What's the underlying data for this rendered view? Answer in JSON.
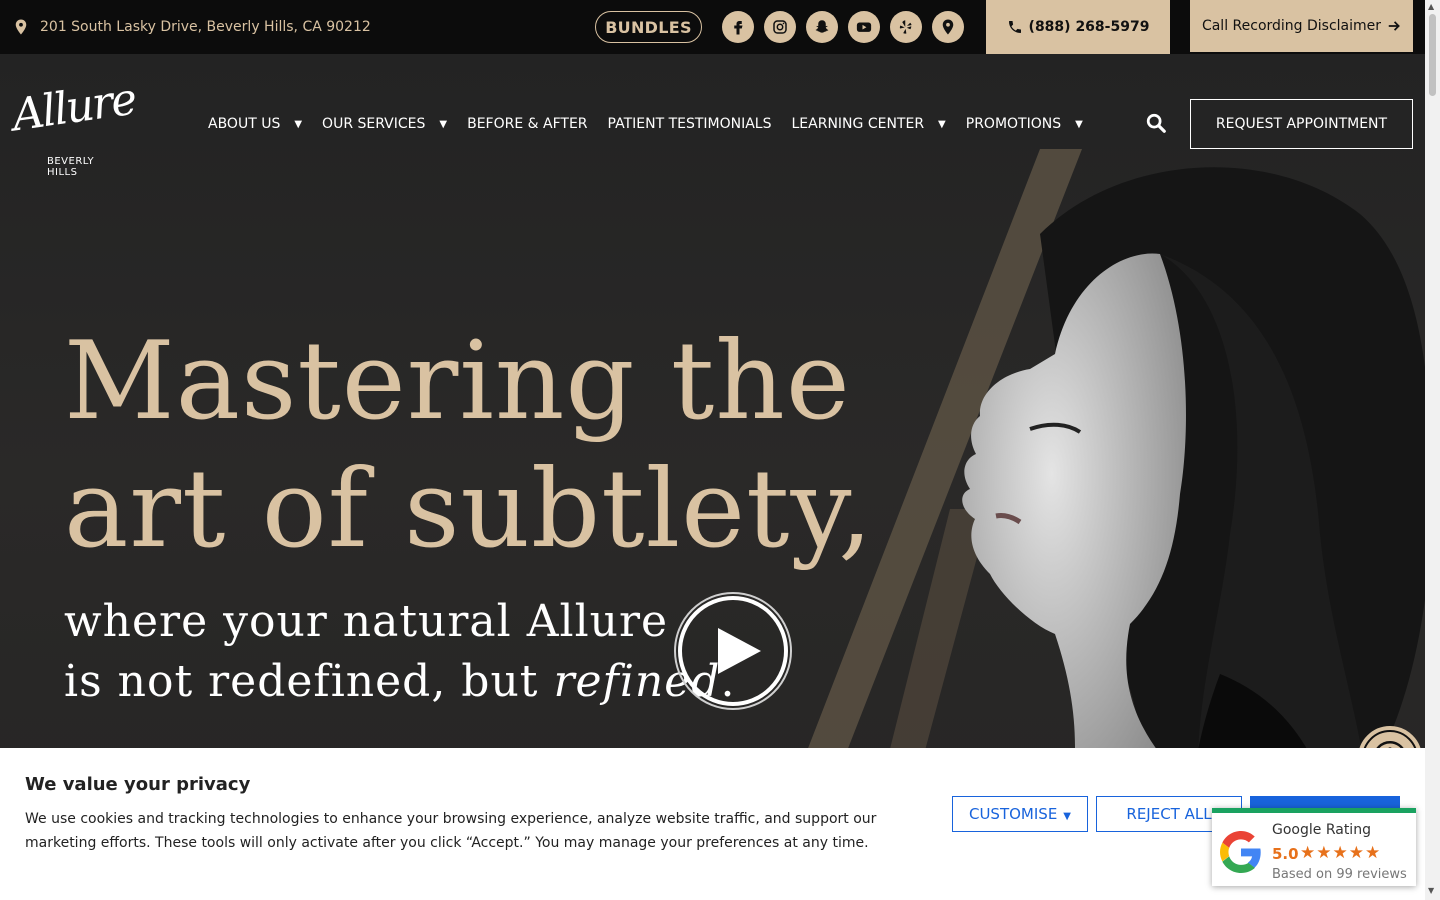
{
  "topbar": {
    "address": "201 South Lasky Drive, Beverly Hills, CA 90212",
    "bundles_label": "BUNDLES",
    "socials": [
      "facebook-icon",
      "instagram-icon",
      "snapchat-icon",
      "youtube-icon",
      "yelp-icon",
      "map-pin-icon"
    ],
    "phone": "(888) 268-5979",
    "disclaimer_label": "Call Recording Disclaimer"
  },
  "brand": {
    "logo_script": "Allure",
    "logo_sub": "BEVERLY HILLS"
  },
  "nav": {
    "items": [
      {
        "label": "ABOUT US",
        "dropdown": true
      },
      {
        "label": "OUR SERVICES",
        "dropdown": true
      },
      {
        "label": "BEFORE & AFTER",
        "dropdown": false
      },
      {
        "label": "PATIENT TESTIMONIALS",
        "dropdown": false
      },
      {
        "label": "LEARNING CENTER",
        "dropdown": true
      },
      {
        "label": "PROMOTIONS",
        "dropdown": true
      }
    ],
    "request_label": "REQUEST APPOINTMENT"
  },
  "hero": {
    "headline_line1": "Mastering the",
    "headline_line2": "art of subtlety,",
    "sub_line1": "where your natural Allure",
    "sub_line2_prefix": "is not redefined, but ",
    "sub_line2_emph": "refined",
    "sub_line2_suffix": "."
  },
  "cookie": {
    "title": "We value your privacy",
    "text": "We use cookies and tracking technologies to enhance your browsing experience, analyze website traffic, and support our marketing efforts. These tools will only activate after you click “Accept.” You may manage your preferences at any time.",
    "customise_label": "CUSTOMISE",
    "reject_label": "REJECT ALL",
    "accept_label": ""
  },
  "google_rating": {
    "title": "Google Rating",
    "score": "5.0",
    "stars": "★★★★★",
    "reviews": "Based on 99 reviews"
  },
  "colors": {
    "gold": "#d9c2a2",
    "dark": "#0c0c0c",
    "cookie_blue": "#1863dc",
    "google_orange": "#e7711b"
  }
}
